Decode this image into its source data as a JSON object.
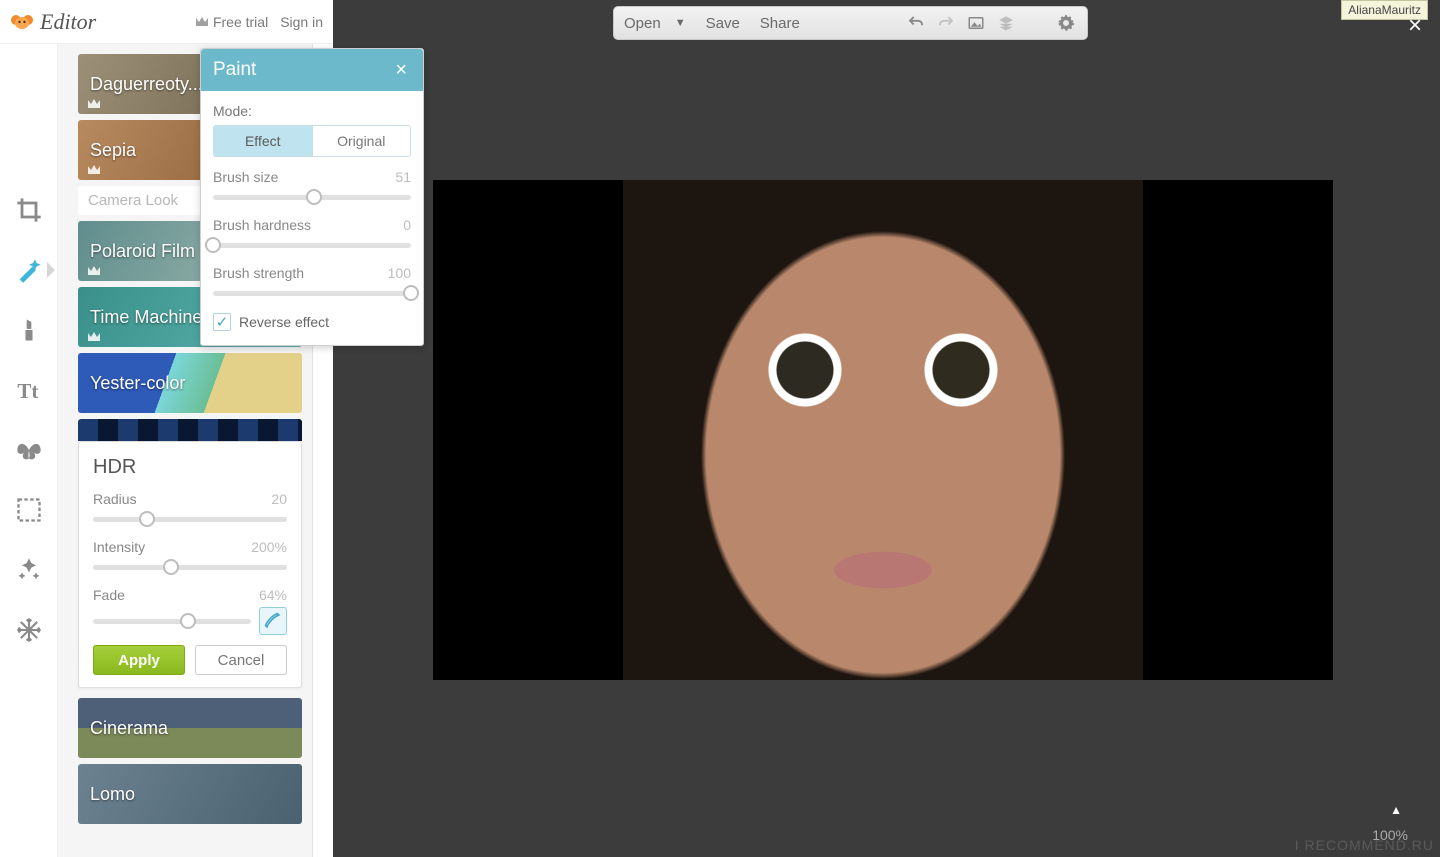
{
  "header": {
    "app_name": "Editor",
    "free_trial": "Free trial",
    "sign_in": "Sign in"
  },
  "tools": {
    "crop": "crop",
    "magic": "effects",
    "touchup": "touchup",
    "text": "text",
    "overlay": "overlay",
    "frame": "frame",
    "texture": "texture",
    "theme": "theme"
  },
  "effects": {
    "camera_look": "Camera Look",
    "items": {
      "daguerreo": "Daguerreoty...",
      "sepia": "Sepia",
      "polaroid": "Polaroid Film",
      "timemachine": "Time Machine",
      "yester": "Yester-color",
      "hdr": "HDR",
      "cinerama": "Cinerama",
      "lomo": "Lomo"
    }
  },
  "hdr": {
    "radius_label": "Radius",
    "radius_value": "20",
    "radius_pct": 28,
    "intensity_label": "Intensity",
    "intensity_value": "200%",
    "intensity_pct": 40,
    "fade_label": "Fade",
    "fade_value": "64%",
    "fade_pct": 60,
    "apply": "Apply",
    "cancel": "Cancel"
  },
  "paint": {
    "title": "Paint",
    "mode_label": "Mode:",
    "effect": "Effect",
    "original": "Original",
    "brush_size_label": "Brush size",
    "brush_size_value": "51",
    "brush_size_pct": 51,
    "brush_hardness_label": "Brush hardness",
    "brush_hardness_value": "0",
    "brush_hardness_pct": 0,
    "brush_strength_label": "Brush strength",
    "brush_strength_value": "100",
    "brush_strength_pct": 100,
    "reverse": "Reverse effect"
  },
  "toolbar": {
    "open": "Open",
    "save": "Save",
    "share": "Share"
  },
  "overlay": {
    "user": "AlianaMauritz",
    "zoom": "100%",
    "watermark": "I RECOMMEND.RU"
  }
}
